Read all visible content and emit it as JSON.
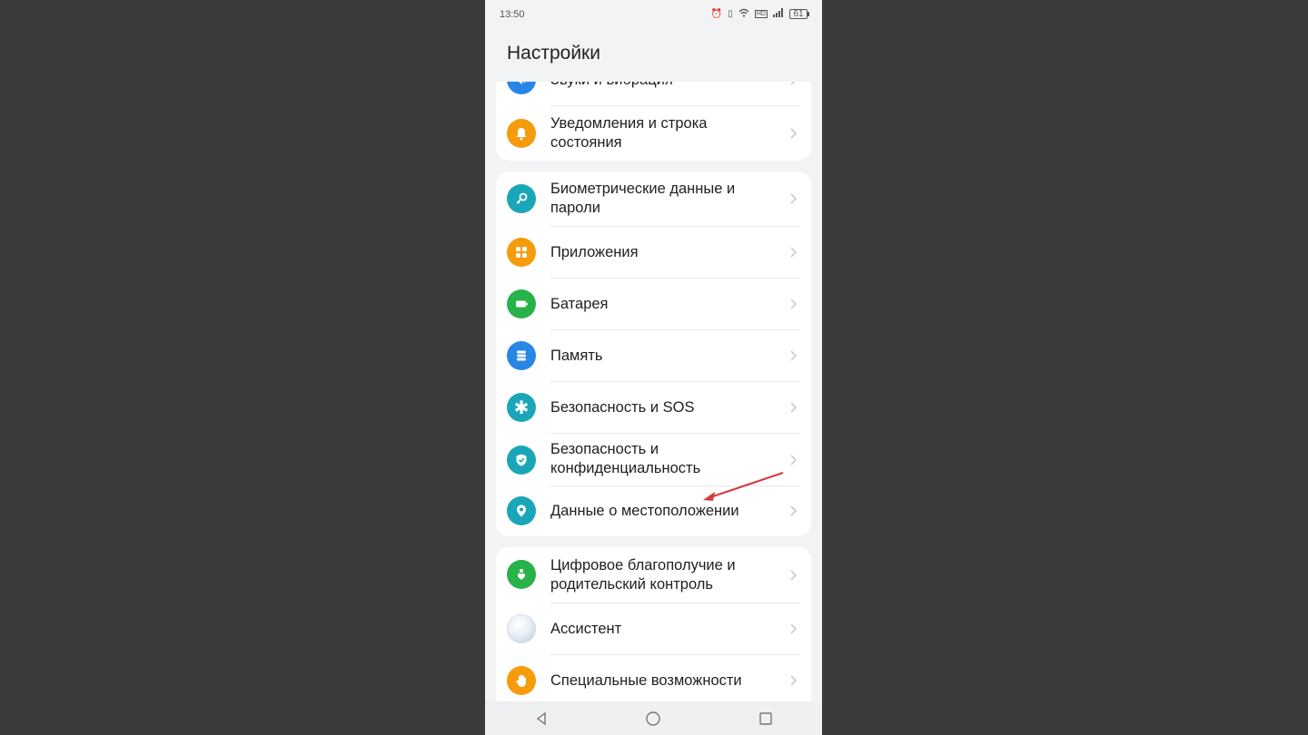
{
  "status_bar": {
    "time": "13:50",
    "battery": "61"
  },
  "header": {
    "title": "Настройки"
  },
  "groups": [
    {
      "items": [
        {
          "label": "Звуки и вибрация",
          "icon": "sound-icon",
          "color": "#2a86e6"
        },
        {
          "label": "Уведомления и строка состояния",
          "icon": "bell-icon",
          "color": "#f59b0c"
        }
      ]
    },
    {
      "items": [
        {
          "label": "Биометрические данные и пароли",
          "icon": "key-icon",
          "color": "#1aa6b8"
        },
        {
          "label": "Приложения",
          "icon": "apps-grid-icon",
          "color": "#f59b0c"
        },
        {
          "label": "Батарея",
          "icon": "battery-icon",
          "color": "#27b24a"
        },
        {
          "label": "Память",
          "icon": "storage-icon",
          "color": "#2a86e6"
        },
        {
          "label": "Безопасность и SOS",
          "icon": "asterisk-icon",
          "color": "#1aa6b8"
        },
        {
          "label": "Безопасность и конфиденциальность",
          "icon": "shield-icon",
          "color": "#1aa6b8"
        },
        {
          "label": "Данные о местоположении",
          "icon": "location-pin-icon",
          "color": "#1aa6b8"
        }
      ]
    },
    {
      "items": [
        {
          "label": "Цифровое благополучие и родительский контроль",
          "icon": "wellbeing-icon",
          "color": "#27b24a"
        },
        {
          "label": "Ассистент",
          "icon": "assistant-orb-icon",
          "color": "#cfd8e6"
        },
        {
          "label": "Специальные возможности",
          "icon": "hand-icon",
          "color": "#f59b0c"
        }
      ]
    }
  ],
  "navigation": {
    "back": "back-icon",
    "home": "home-icon",
    "recents": "recents-icon"
  },
  "annotation": {
    "arrow_color": "#d23b3b"
  }
}
